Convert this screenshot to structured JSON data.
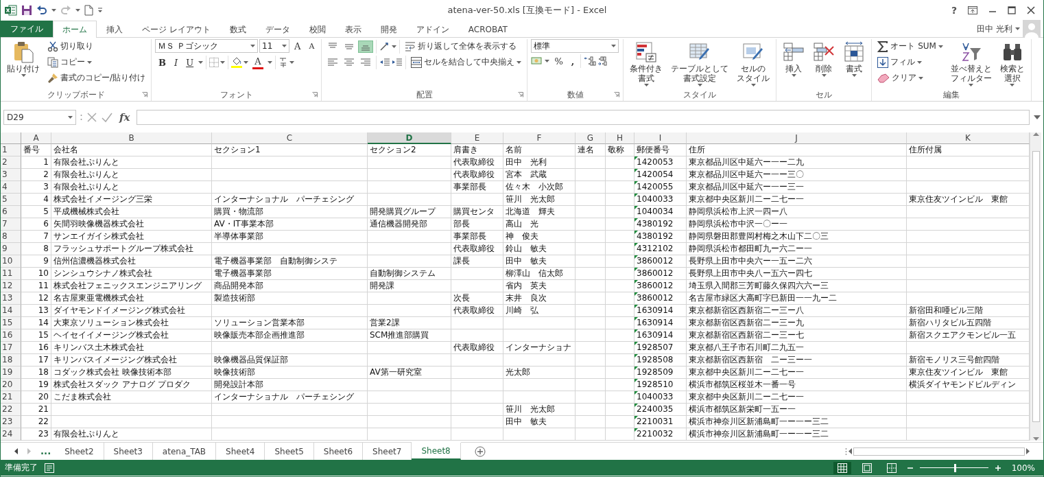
{
  "window": {
    "title": "atena-ver-50.xls  [互換モード] - Excel",
    "help": "?",
    "user": "田中 光利"
  },
  "ribbon_tabs": [
    {
      "label": "ファイル",
      "kind": "file",
      "selected": false
    },
    {
      "label": "ホーム",
      "kind": "tab",
      "selected": true
    },
    {
      "label": "挿入",
      "kind": "tab",
      "selected": false
    },
    {
      "label": "ページ レイアウト",
      "kind": "tab",
      "selected": false
    },
    {
      "label": "数式",
      "kind": "tab",
      "selected": false
    },
    {
      "label": "データ",
      "kind": "tab",
      "selected": false
    },
    {
      "label": "校閲",
      "kind": "tab",
      "selected": false
    },
    {
      "label": "表示",
      "kind": "tab",
      "selected": false
    },
    {
      "label": "開発",
      "kind": "tab",
      "selected": false
    },
    {
      "label": "アドイン",
      "kind": "tab",
      "selected": false
    },
    {
      "label": "ACROBAT",
      "kind": "tab",
      "selected": false
    }
  ],
  "ribbon_groups": [
    {
      "kind": "clipboard",
      "name": "クリップボード",
      "paste": "貼り付け",
      "commands": [
        {
          "label": "切り取り",
          "dropdown": false
        },
        {
          "label": "コピー",
          "dropdown": true
        },
        {
          "label": "書式のコピー/貼り付け",
          "dropdown": false
        }
      ]
    },
    {
      "kind": "font",
      "name": "フォント",
      "font_name": "ＭＳ Ｐゴシック",
      "font_size": "11",
      "grow": "A",
      "shrink": "A",
      "bold": "B",
      "italic": "I",
      "underline": "U",
      "font_color": "A"
    },
    {
      "kind": "alignment",
      "name": "配置",
      "align_buttons": [
        {
          "selected": false
        },
        {
          "selected": false
        },
        {
          "selected": true
        },
        {
          "selected": false
        },
        {
          "selected": false
        },
        {
          "selected": false
        }
      ],
      "wrap_text": "折り返して全体を表示する",
      "merge_center": "セルを結合して中央揃え"
    },
    {
      "kind": "number",
      "name": "数値",
      "format": "標準",
      "percent": "%",
      "comma": ","
    },
    {
      "kind": "styles",
      "name": "スタイル",
      "items": [
        {
          "lines": [
            "条件付き",
            "書式"
          ]
        },
        {
          "lines": [
            "テーブルとして",
            "書式設定"
          ]
        },
        {
          "lines": [
            "セルの",
            "スタイル"
          ]
        }
      ]
    },
    {
      "kind": "cells",
      "name": "セル",
      "items": [
        {
          "lines": [
            "挿入"
          ]
        },
        {
          "lines": [
            "削除"
          ]
        },
        {
          "lines": [
            "書式"
          ]
        }
      ]
    },
    {
      "kind": "editing",
      "name": "編集",
      "commands": [
        {
          "label": "オート SUM",
          "dropdown": true
        },
        {
          "label": "フィル",
          "dropdown": true
        },
        {
          "label": "クリア",
          "dropdown": true
        }
      ],
      "items": [
        {
          "lines": [
            "並べ替えと",
            "フィルター"
          ]
        },
        {
          "lines": [
            "検索と",
            "選択"
          ]
        }
      ]
    }
  ],
  "formula_bar": {
    "name_box": "D29",
    "function_label": "fx"
  },
  "table": {
    "columns": [
      {
        "letter": "A",
        "selected": false
      },
      {
        "letter": "B",
        "selected": false
      },
      {
        "letter": "C",
        "selected": false
      },
      {
        "letter": "D",
        "selected": true
      },
      {
        "letter": "E",
        "selected": false
      },
      {
        "letter": "F",
        "selected": false
      },
      {
        "letter": "G",
        "selected": false
      },
      {
        "letter": "H",
        "selected": false
      },
      {
        "letter": "I",
        "selected": false
      },
      {
        "letter": "J",
        "selected": false
      },
      {
        "letter": "K",
        "selected": false
      }
    ],
    "rows": [
      {
        "row": "1",
        "A": "番号",
        "B": "会社名",
        "C": "セクション1",
        "D": "セクション2",
        "E": "肩書き",
        "F": "名前",
        "G": "連名",
        "H": "敬称",
        "I": "郵便番号",
        "J": "住所",
        "K": "住所付属"
      },
      {
        "row": "2",
        "A": "1",
        "B": "有限会社ぷりんと",
        "E": "代表取締役",
        "F": "田中　光利",
        "I": "1420053",
        "J": "東京都品川区中延六ー一ー二九"
      },
      {
        "row": "3",
        "A": "2",
        "B": "有限会社ぷりんと",
        "E": "代表取締役",
        "F": "宮本　武蔵",
        "I": "1420054",
        "J": "東京都品川区中延六ー一ー三〇"
      },
      {
        "row": "4",
        "A": "3",
        "B": "有限会社ぷりんと",
        "E": "事業部長",
        "F": "佐々木　小次郎",
        "I": "1420055",
        "J": "東京都品川区中延六ー一ー三一"
      },
      {
        "row": "5",
        "A": "4",
        "B": "株式会社イメージング三栄",
        "C": "インターナショナル　パーチェシング",
        "F": "笹川　光太郎",
        "I": "1040033",
        "J": "東京都中央区新川二ー二七ー一",
        "K": "東京住友ツインビル　東館"
      },
      {
        "row": "6",
        "A": "5",
        "B": "平成機械株式会社",
        "C": "購買・物流部",
        "D": "開発購買グループ",
        "E": "購買センタ",
        "F": "北海道　輝夫",
        "I": "1040034",
        "J": "静岡県浜松市上沢一四ー八"
      },
      {
        "row": "7",
        "A": "6",
        "B": "矢間羽映像機器株式会社",
        "C": "AV・IT事業本部",
        "D": "通信機器開発部",
        "E": "部長",
        "F": "高山　光",
        "I": "4380192",
        "J": "静岡県浜松市中沢一〇ー一"
      },
      {
        "row": "8",
        "A": "7",
        "B": "サンエイガイシ株式会社",
        "C": "半導体事業部",
        "E": "事業部長",
        "F": "神　俊夫",
        "I": "4380192",
        "J": "静岡県磐田郡豊岡村梅之木山下二〇三"
      },
      {
        "row": "9",
        "A": "8",
        "B": "フラッシュサポートグループ株式会社",
        "E": "代表取締役",
        "F": "鈴山　敏夫",
        "I": "4312102",
        "J": "静岡県浜松市都田町九ー六二ー一"
      },
      {
        "row": "10",
        "A": "9",
        "B": "信州信濃機器株式会社",
        "C": "電子機器事業部　自動制御システ",
        "E": "課長",
        "F": "田中　敏夫",
        "I": "3860012",
        "J": "長野県上田市中央六ー一五ー二六"
      },
      {
        "row": "11",
        "A": "10",
        "B": "シンシュウシナノ株式会社",
        "C": "電子機器事業部",
        "D": "自動制御システム",
        "F": "柳澤山　信太郎",
        "I": "3860012",
        "J": "長野県上田市中央八ー五六ー四七"
      },
      {
        "row": "12",
        "A": "11",
        "B": "株式会社フェニックスエンジニアリング",
        "C": "商品開発本部",
        "D": "開発課",
        "F": "省内　英夫",
        "I": "3860012",
        "J": "埼玉県入間郡三芳町藤久保四六六ー三"
      },
      {
        "row": "13",
        "A": "12",
        "B": "名古屋東亜電機株式会社",
        "C": "製造技術部",
        "E": "次長",
        "F": "末井　良次",
        "I": "3860012",
        "J": "名古屋市緑区大高町字巳新田一一九ー二"
      },
      {
        "row": "14",
        "A": "13",
        "B": "ダイヤモンドイメージング株式会社",
        "E": "代表取締役",
        "F": "川崎　弘",
        "I": "1630914",
        "J": "東京都新宿区西新宿二ー三ー八",
        "K": "新宿田和唖ビル三階"
      },
      {
        "row": "15",
        "A": "14",
        "B": "大東京ソリューション株式会社",
        "C": "ソリューション営業本部",
        "D": "営業2課",
        "I": "1630914",
        "J": "東京都新宿区西新宿二ー三ー九",
        "K": "新宿ハリタビル五四階"
      },
      {
        "row": "16",
        "A": "15",
        "B": "ヘイセイイメージング株式会社",
        "C": "映像販売本部企画推進部",
        "D": "SCM推進部購買",
        "I": "1630914",
        "J": "東京都新宿区西新宿二ー三ー七",
        "K": "新宿スクエアクモンビル一五"
      },
      {
        "row": "17",
        "A": "16",
        "B": "キリンバス土木株式会社",
        "E": "代表取締役",
        "F": "インターナショナ",
        "I": "1928507",
        "J": "東京都八王子市石川町二九五一"
      },
      {
        "row": "18",
        "A": "17",
        "B": "キリンバスイメージング株式会社",
        "C": "映像機器品質保証部",
        "I": "1928508",
        "J": "東京都新宿区西新宿　二ー三ー一",
        "K": "新宿モノリス三号館四階"
      },
      {
        "row": "19",
        "A": "18",
        "B": "コダック株式会社 映像技術本部",
        "C": "映像技術部",
        "D": "AV第一研究室",
        "F": "光太郎",
        "I": "1928509",
        "J": "東京都中央区新川二ー二七ー一",
        "K": "東京住友ツインビル　東館"
      },
      {
        "row": "20",
        "A": "19",
        "B": "株式会社スダック アナログ プロダク",
        "C": "開発設計本部",
        "I": "1928510",
        "J": "横浜市都筑区桜並木一番一号",
        "K": "横浜ダイヤモンドビルディン"
      },
      {
        "row": "21",
        "A": "20",
        "B": "こだま株式会社",
        "C": "インターナショナル　パーチェシング",
        "I": "1040033",
        "J": "東京都中央区新川二ー二七ー一"
      },
      {
        "row": "22",
        "A": "21",
        "F": "笹川　光太郎",
        "I": "2240035",
        "J": "横浜市都筑区新栄町一五ー一"
      },
      {
        "row": "23",
        "A": "22",
        "F": "田中　敏夫",
        "I": "2210031",
        "J": "横浜市神奈川区新浦島町一ー一ー三二"
      },
      {
        "row": "24",
        "A": "23",
        "B": "有限会社ぷりんと",
        "I": "2210032",
        "J": "横浜市神奈川区新浦島町一ー一ー三二"
      }
    ]
  },
  "sheet_tabs": {
    "overflow": "...",
    "tabs": [
      {
        "label": "Sheet2",
        "selected": false
      },
      {
        "label": "Sheet3",
        "selected": false
      },
      {
        "label": "atena_TAB",
        "selected": false
      },
      {
        "label": "Sheet4",
        "selected": false
      },
      {
        "label": "Sheet5",
        "selected": false
      },
      {
        "label": "Sheet6",
        "selected": false
      },
      {
        "label": "Sheet7",
        "selected": false
      },
      {
        "label": "Sheet8",
        "selected": true
      }
    ]
  },
  "status_bar": {
    "status": "準備完了",
    "views": [
      {
        "selected": true
      },
      {
        "selected": false
      },
      {
        "selected": false
      }
    ],
    "zoom_slider": {
      "level": 0.5
    },
    "zoom": "100%"
  }
}
